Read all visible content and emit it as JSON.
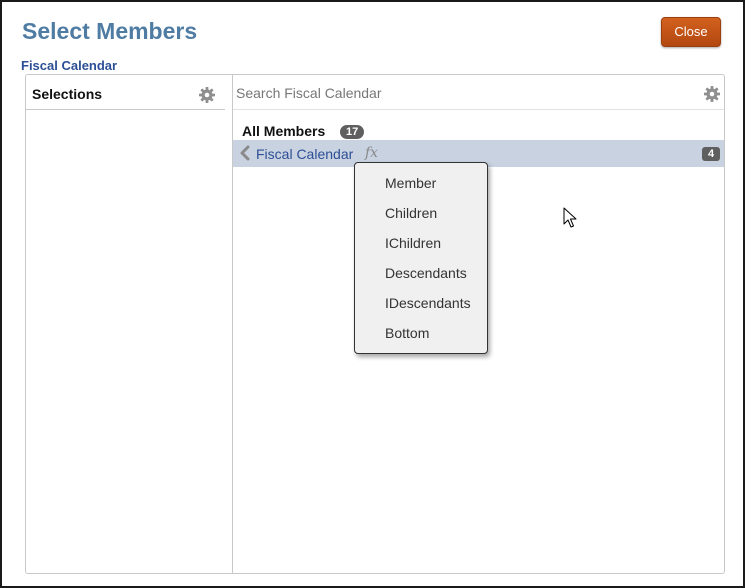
{
  "dialog": {
    "title": "Select Members",
    "close_label": "Close",
    "dimension": "Fiscal Calendar"
  },
  "selections": {
    "header": "Selections"
  },
  "browser": {
    "search_placeholder": "Search Fiscal Calendar",
    "all_members_label": "All Members",
    "all_members_count": "17",
    "member": {
      "label": "Fiscal Calendar",
      "function_icon": "fx",
      "count": "4"
    }
  },
  "context_menu": {
    "items": [
      "Member",
      "Children",
      "IChildren",
      "Descendants",
      "IDescendants",
      "Bottom"
    ]
  },
  "icons": {
    "selections_settings": "gear-icon",
    "search_settings": "gear-icon",
    "back": "chevron-left-icon",
    "function": "fx-icon",
    "cursor": "mouse-pointer-icon"
  },
  "colors": {
    "title": "#4f7ca3",
    "accent_button": "#c4561a",
    "link": "#2d4f96",
    "selected_row": "#c8d2e0",
    "badge": "#5f5f5f"
  }
}
